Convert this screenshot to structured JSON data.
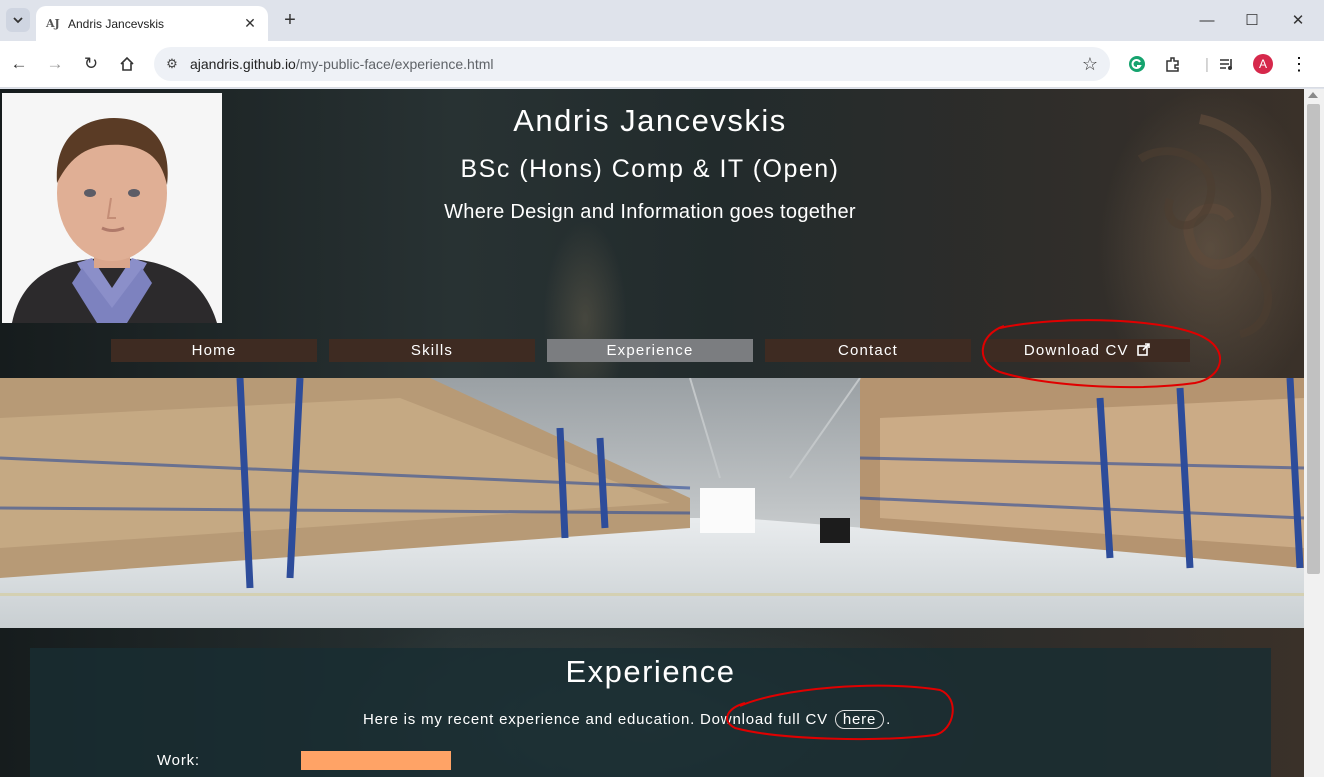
{
  "browser": {
    "tab_title": "Andris Jancevskis",
    "tab_favicon_text": "AJ",
    "url_host": "ajandris.github.io",
    "url_path": "/my-public-face/experience.html",
    "profile_initial": "A"
  },
  "header": {
    "name": "Andris Jancevskis",
    "degree": "BSc (Hons) Comp & IT (Open)",
    "tagline": "Where Design and Information goes together"
  },
  "nav": {
    "items": [
      {
        "label": "Home",
        "active": false
      },
      {
        "label": "Skills",
        "active": false
      },
      {
        "label": "Experience",
        "active": true
      },
      {
        "label": "Contact",
        "active": false
      },
      {
        "label": "Download CV",
        "active": false
      }
    ]
  },
  "main": {
    "title": "Experience",
    "intro_text": "Here is my recent experience and education. Download full CV",
    "here_link": "here",
    "intro_end": ".",
    "work_label": "Work:"
  },
  "colors": {
    "nav_bg": "#3e2b22",
    "nav_active": "#7b7d80",
    "work_bar": "#ffa366",
    "annotation": "#e00000"
  }
}
